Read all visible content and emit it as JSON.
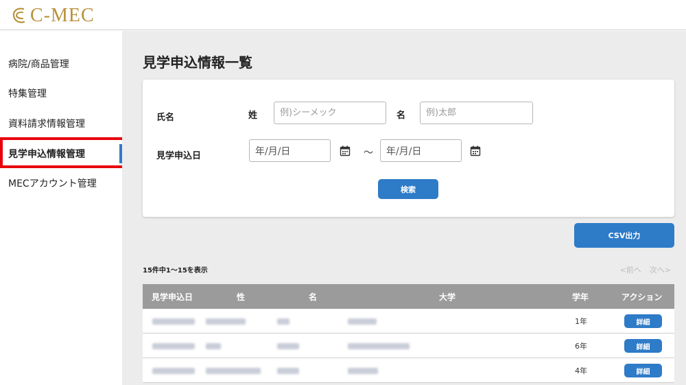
{
  "header": {
    "logo_text": "C-MEC"
  },
  "sidebar": {
    "items": [
      {
        "label": "病院/商品管理"
      },
      {
        "label": "特集管理"
      },
      {
        "label": "資料請求情報管理"
      },
      {
        "label": "見学申込情報管理",
        "active": true
      },
      {
        "label": "MECアカウント管理"
      }
    ]
  },
  "main": {
    "page_title": "見学申込情報一覧",
    "search": {
      "name_label": "氏名",
      "last_name_label": "姓",
      "last_name_placeholder": "例)シーメック",
      "first_name_label": "名",
      "first_name_placeholder": "例)太郎",
      "date_label": "見学申込日",
      "date_from_placeholder": "年/月/日",
      "date_separator": "～",
      "date_to_placeholder": "年/月/日",
      "search_button": "検索"
    },
    "csv_button": "CSV出力",
    "result_count": "15件中1～15を表示",
    "pager": {
      "prev": "<前へ",
      "next": "次へ>"
    },
    "table": {
      "headers": [
        "見学申込日",
        "性",
        "名",
        "大学",
        "学年",
        "アクション"
      ],
      "rows": [
        {
          "grade": "1年",
          "action": "詳細"
        },
        {
          "grade": "6年",
          "action": "詳細"
        },
        {
          "grade": "4年",
          "action": "詳細"
        }
      ]
    }
  },
  "colors": {
    "accent": "#2e7bc8",
    "brand": "#b8923b",
    "highlight": "#e8000b",
    "table_header": "#9b9b9b"
  }
}
